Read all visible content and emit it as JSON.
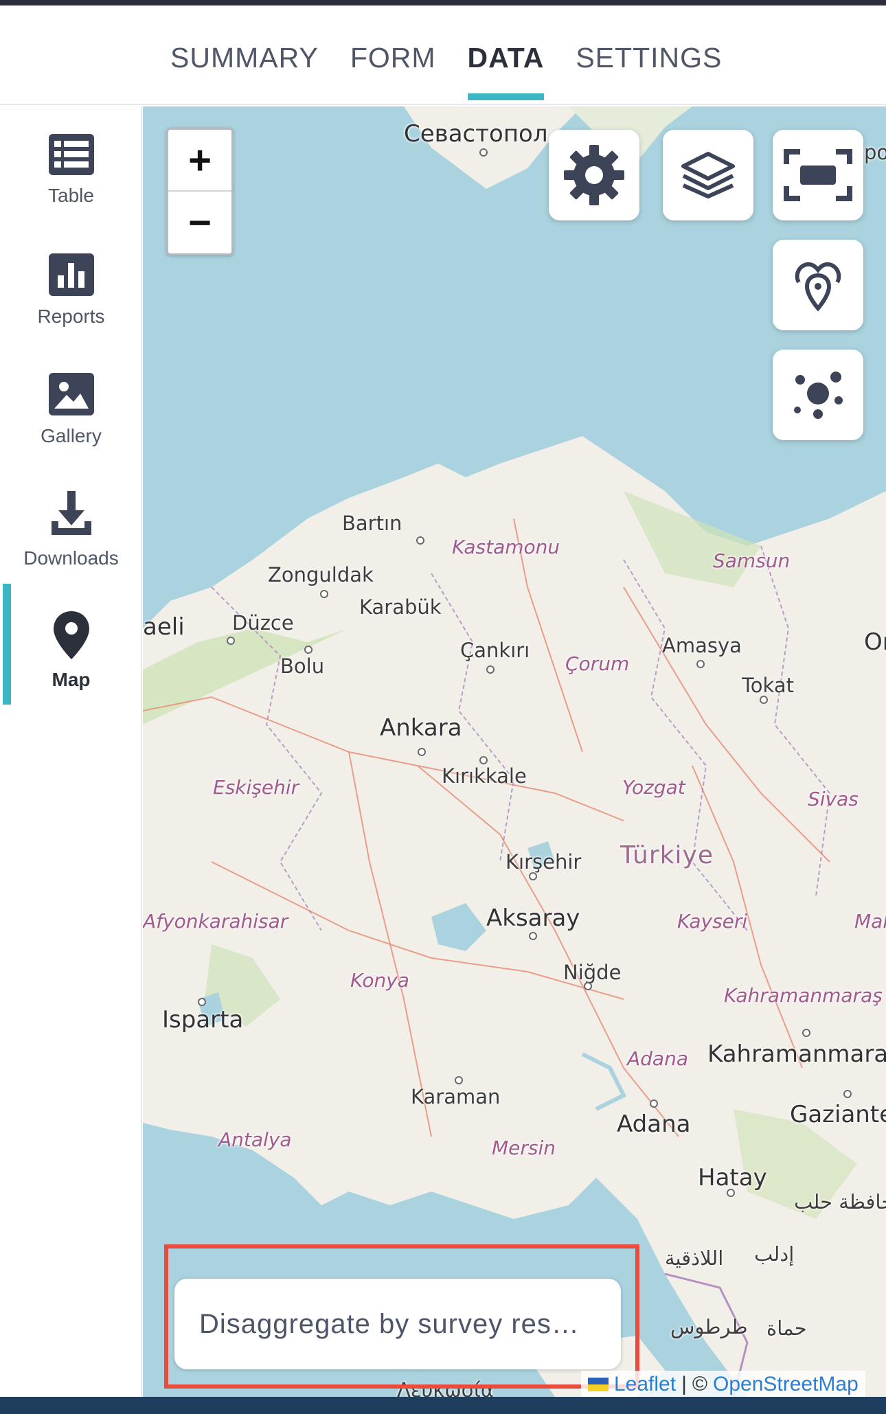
{
  "tabs": [
    {
      "label": "SUMMARY",
      "active": false
    },
    {
      "label": "FORM",
      "active": false
    },
    {
      "label": "DATA",
      "active": true
    },
    {
      "label": "SETTINGS",
      "active": false
    }
  ],
  "sidebar": {
    "items": [
      {
        "label": "Table",
        "icon": "table-icon"
      },
      {
        "label": "Reports",
        "icon": "bar-chart-icon"
      },
      {
        "label": "Gallery",
        "icon": "image-icon"
      },
      {
        "label": "Downloads",
        "icon": "download-icon"
      },
      {
        "label": "Map",
        "icon": "map-pin-icon",
        "active": true
      }
    ]
  },
  "map": {
    "zoom": {
      "in_label": "+",
      "out_label": "−"
    },
    "controls": [
      "settings-gear-icon",
      "layers-icon",
      "fullscreen-icon",
      "heatmap-icon",
      "cluster-icon"
    ],
    "labels": {
      "sevastopol": "Севастопол",
      "bartin": "Bartın",
      "kastamonu": "Kastamonu",
      "samsun": "Samsun",
      "zonguldak": "Zonguldak",
      "karabuk": "Karabük",
      "kocaeli": "aeli",
      "duzce": "Düzce",
      "bolu": "Bolu",
      "cankiri": "Çankırı",
      "corum": "Çorum",
      "amasya": "Amasya",
      "tokat": "Tokat",
      "ordu": "Or",
      "ankara": "Ankara",
      "kirikkale": "Kırıkkale",
      "eskisehir": "Eskişehir",
      "yozgat": "Yozgat",
      "sivas": "Sivas",
      "kirsehir": "Kırşehir",
      "turkiye": "Türkiye",
      "afyon": "Afyonkarahisar",
      "aksaray": "Aksaray",
      "kayseri": "Kayseri",
      "malatya": "Mal",
      "konya": "Konya",
      "nigde": "Niğde",
      "kahramanmaras_region": "Kahramanmaraş",
      "isparta": "Isparta",
      "adana_region": "Adana",
      "kahramanmaras_city": "Kahramanmara",
      "karaman": "Karaman",
      "antalya": "Antalya",
      "mersin": "Mersin",
      "adana_city": "Adana",
      "gaziantep": "Gaziante",
      "hatay": "Hatay",
      "aleppo": "حافظة حلب",
      "latakia": "اللاذقية",
      "idlib": "إدلب",
      "tartus": "طرطوس",
      "hama": "حماة",
      "cyprus": "Λευκωσία",
      "po": "po"
    },
    "disaggregate_label": "Disaggregate by survey res…",
    "attribution": {
      "leaflet": "Leaflet",
      "separator": "|",
      "copyright": "©",
      "osm": "OpenStreetMap"
    }
  },
  "colors": {
    "accent": "#3ab6c4",
    "sea": "#aad3df",
    "land": "#f2efe9",
    "highlight": "#e74c3c"
  }
}
